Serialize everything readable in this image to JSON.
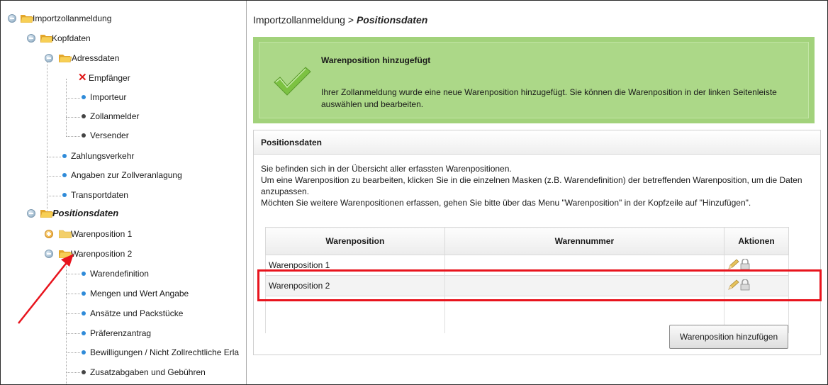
{
  "sidebar": {
    "root": "Importzollanmeldung",
    "kopfdaten": "Kopfdaten",
    "adressdaten": "Adressdaten",
    "empfaenger": "Empfänger",
    "importeur": "Importeur",
    "zollanmelder": "Zollanmelder",
    "versender": "Versender",
    "zahlungsverkehr": "Zahlungsverkehr",
    "angaben": "Angaben zur Zollveranlagung",
    "transportdaten": "Transportdaten",
    "positionsdaten": "Positionsdaten",
    "warenposition1": "Warenposition 1",
    "warenposition2": "Warenposition 2",
    "warendefinition": "Warendefinition",
    "mengen": "Mengen und Wert Angabe",
    "ansaetze": "Ansätze und Packstücke",
    "praeferenz": "Präferenzantrag",
    "bewilligungen": "Bewilligungen / Nicht Zollrechtliche Erla",
    "zusatz": "Zusatzabgaben und Gebühren"
  },
  "breadcrumb": {
    "parent": "Importzollanmeldung",
    "separator": " > ",
    "current": "Positionsdaten"
  },
  "success": {
    "title": "Warenposition hinzugefügt",
    "text": "Ihrer Zollanmeldung wurde eine neue Warenposition hinzugefügt. Sie können die Warenposition in der linken Seitenleiste auswählen und bearbeiten.",
    "color": "#a2d27b"
  },
  "panel": {
    "title": "Positionsdaten",
    "desc1": "Sie befinden sich in der Übersicht aller erfassten Warenpositionen.",
    "desc2": "Um eine Warenposition zu bearbeiten, klicken Sie in die einzelnen Masken (z.B. Warendefinition) der betreffenden Warenposition, um die Daten anzupassen.",
    "desc3": "Möchten Sie weitere Warenpositionen erfassen, gehen Sie bitte über das Menu \"Warenposition\" in der Kopfzeile auf \"Hinzufügen\"."
  },
  "table": {
    "headers": {
      "pos": "Warenposition",
      "nr": "Warennummer",
      "act": "Aktionen"
    },
    "rows": [
      {
        "pos": "Warenposition 1",
        "nr": ""
      },
      {
        "pos": "Warenposition 2",
        "nr": ""
      }
    ]
  },
  "add_button": "Warenposition hinzufügen",
  "annotation": {
    "highlight_color": "#e8141d"
  },
  "icons": [
    "toggle-minus-icon",
    "toggle-plus-icon",
    "folder-icon",
    "folder-open-icon",
    "error-x-icon",
    "bullet-icon",
    "checkmark-icon",
    "edit-pencil-icon",
    "lock-icon",
    "arrow-annotation"
  ]
}
